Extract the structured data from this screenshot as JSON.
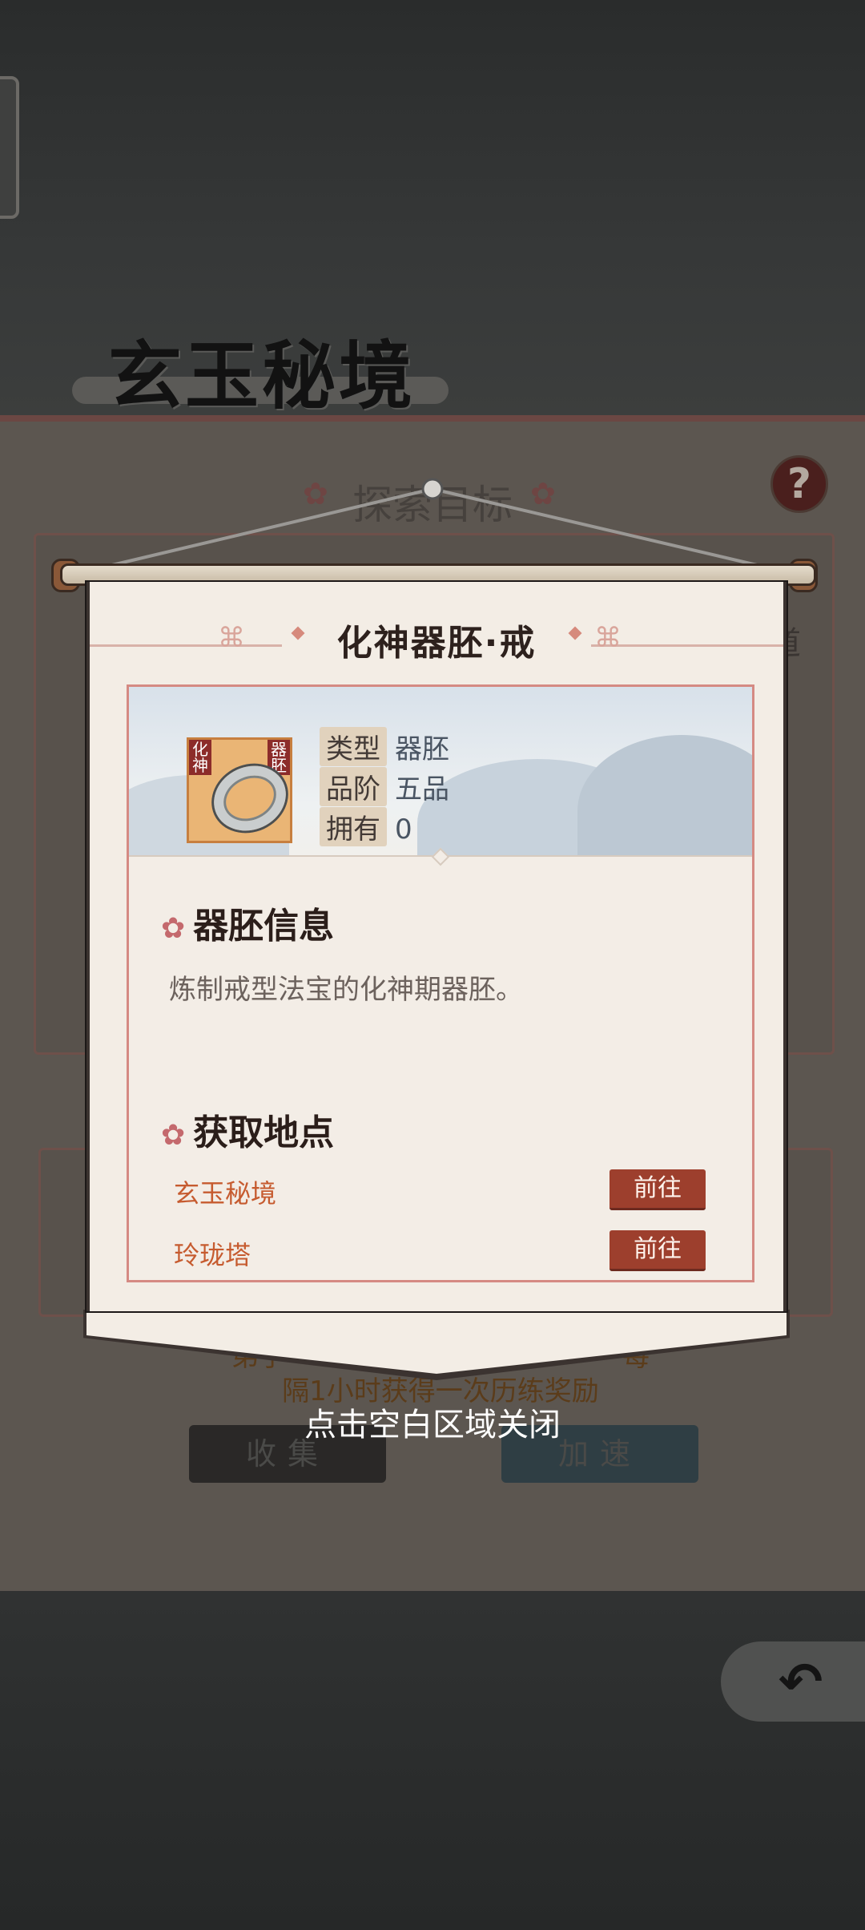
{
  "background": {
    "title": "玄玉秘境",
    "explore_label": "探索目标",
    "help_icon": "?",
    "side_text": "道",
    "reward_text_line1": "弟子",
    "reward_text_line1_end": "每",
    "reward_text_line2": "隔1小时获得一次历练奖励",
    "collect_button": "收集",
    "speed_button": "加速",
    "back_icon": "back-arrow-icon"
  },
  "modal": {
    "title": "化神器胚·戒",
    "item": {
      "icon_tag_left": "化神",
      "icon_tag_right": "器胚",
      "attributes": [
        {
          "label": "类型",
          "value": "器胚"
        },
        {
          "label": "品阶",
          "value": "五品"
        },
        {
          "label": "拥有",
          "value": "0"
        }
      ]
    },
    "info_section": {
      "title": "器胚信息",
      "description": "炼制戒型法宝的化神期器胚。"
    },
    "source_section": {
      "title": "获取地点",
      "locations": [
        {
          "name": "玄玉秘境",
          "button": "前往"
        },
        {
          "name": "玲珑塔",
          "button": "前往"
        }
      ]
    }
  },
  "close_hint": "点击空白区域关闭"
}
